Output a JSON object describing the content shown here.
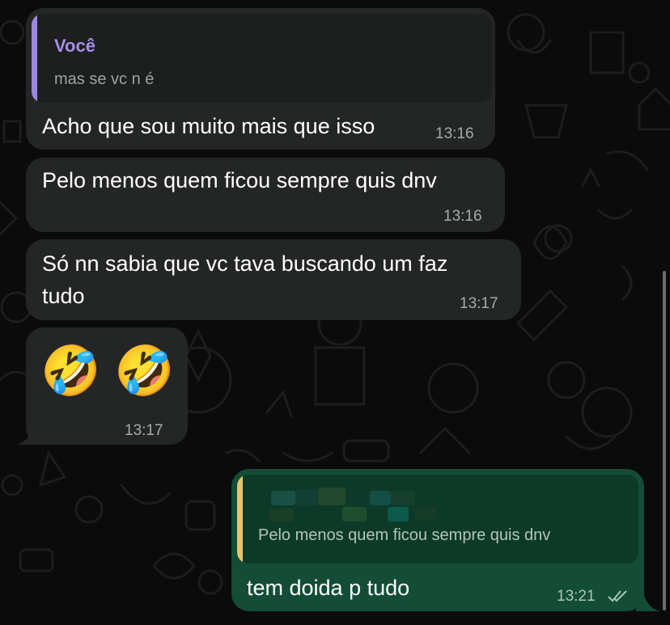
{
  "colors": {
    "background": "#0b0b0b",
    "incoming_bubble": "#242626",
    "outgoing_bubble": "#144d37",
    "quote_author_you": "#a68ee6",
    "quote_bar_incoming": "#9d87e0",
    "quote_bar_outgoing": "#e6c46e",
    "timestamp": "#a8a9aa"
  },
  "messages": [
    {
      "direction": "incoming",
      "reply": {
        "author": "Você",
        "text": "mas se vc n é"
      },
      "text": "Acho que sou muito mais que isso",
      "time": "13:16"
    },
    {
      "direction": "incoming",
      "text": "Pelo menos quem ficou sempre quis dnv",
      "time": "13:16"
    },
    {
      "direction": "incoming",
      "text_line1": "Só nn sabia que vc tava buscando um faz",
      "text_line2": "tudo",
      "time": "13:17"
    },
    {
      "direction": "incoming",
      "emoji": "🤣 🤣",
      "emoji_name": "rolling-on-the-floor-laughing",
      "time": "13:17"
    },
    {
      "direction": "outgoing",
      "reply": {
        "author": "",
        "text": "Pelo menos quem ficou sempre quis dnv",
        "author_obscured": true
      },
      "text": "tem doida p tudo",
      "time": "13:21",
      "status_icon": "double-check-icon"
    }
  ]
}
